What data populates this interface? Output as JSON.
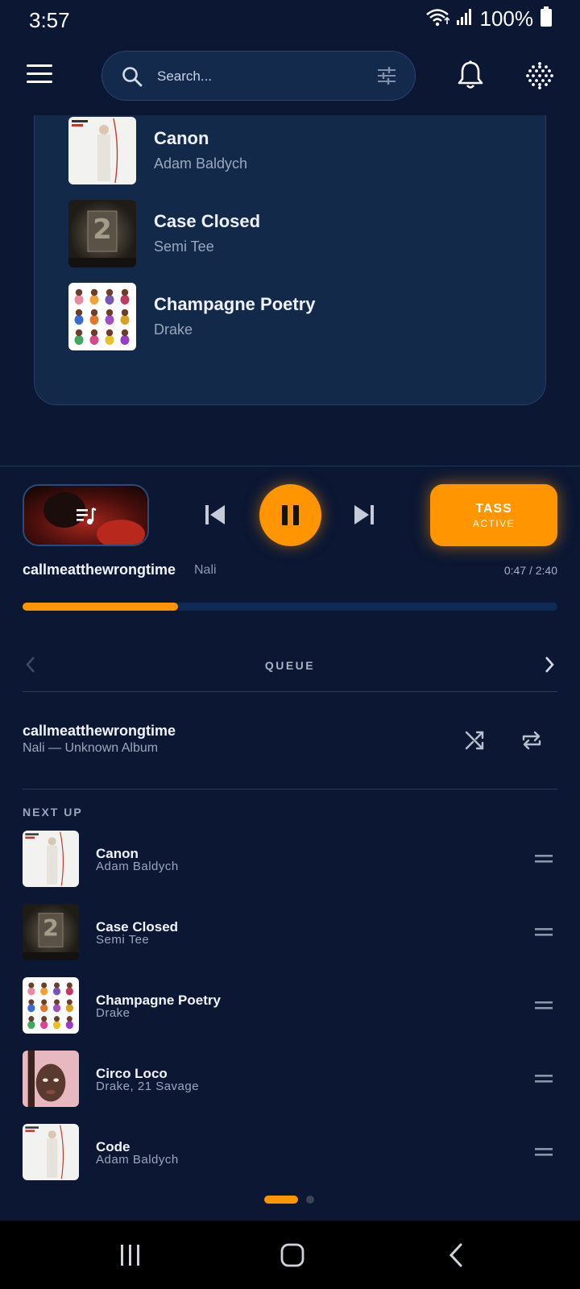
{
  "status": {
    "time": "3:57",
    "battery": "100%"
  },
  "search": {
    "placeholder": "Search..."
  },
  "panel": {
    "items": [
      {
        "title": "Canon",
        "artist": "Adam Baldych",
        "cover": "portraits-cover"
      },
      {
        "title": "Case Closed",
        "artist": "Semi Tee",
        "cover": "peers-cover"
      },
      {
        "title": "Champagne Poetry",
        "artist": "Drake",
        "cover": "certified-lover-boy-cover"
      }
    ]
  },
  "player": {
    "title": "callmeatthewrongtime",
    "artist": "Nali",
    "time": "0:47 / 2:40",
    "progress": 0.29,
    "tass_title": "TASS",
    "tass_status": "ACTIVE",
    "accent": "#ff9500"
  },
  "queue": {
    "label": "QUEUE",
    "current_title": "callmeatthewrongtime",
    "current_sub": "Nali — Unknown Album",
    "next_up_label": "NEXT UP",
    "items": [
      {
        "title": "Canon",
        "artist": "Adam Baldych",
        "cover": "portraits-cover"
      },
      {
        "title": "Case Closed",
        "artist": "Semi Tee",
        "cover": "peers-cover"
      },
      {
        "title": "Champagne Poetry",
        "artist": "Drake",
        "cover": "certified-lover-boy-cover"
      },
      {
        "title": "Circo Loco",
        "artist": "Drake, 21 Savage",
        "cover": "her-loss-cover"
      },
      {
        "title": "Code",
        "artist": "Adam Baldych",
        "cover": "portraits-cover"
      }
    ]
  },
  "pager": {
    "pages": 2,
    "active": 0
  },
  "colors": {
    "background": "#0b1733",
    "panel": "#13294a",
    "accent": "#ff9500"
  }
}
